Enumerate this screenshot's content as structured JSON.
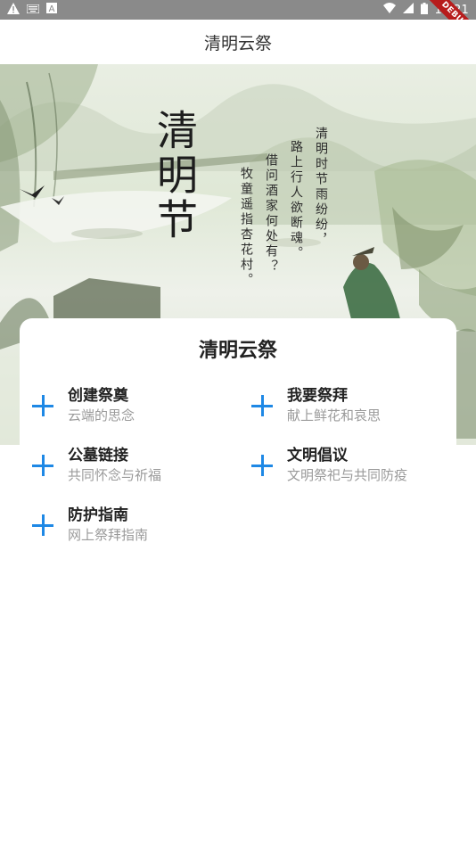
{
  "status_bar": {
    "time": "17:21",
    "debug_label": "DEBUG",
    "left_icons": [
      "warning-icon",
      "keyboard-icon",
      "a-box-icon"
    ],
    "right_icons": [
      "wifi-icon",
      "signal-icon",
      "battery-icon"
    ]
  },
  "appbar": {
    "title": "清明云祭"
  },
  "banner": {
    "calligraphy": "清明节",
    "poem": [
      "清明时节雨纷纷，",
      "路上行人欲断魂。",
      "借问酒家何处有？",
      "牧童遥指杏花村。"
    ]
  },
  "card": {
    "title": "清明云祭",
    "items": [
      {
        "title": "创建祭奠",
        "subtitle": "云端的思念",
        "icon": "plus-icon"
      },
      {
        "title": "我要祭拜",
        "subtitle": "献上鲜花和哀思",
        "icon": "plus-icon"
      },
      {
        "title": "公墓链接",
        "subtitle": "共同怀念与祈福",
        "icon": "plus-icon"
      },
      {
        "title": "文明倡议",
        "subtitle": "文明祭祀与共同防疫",
        "icon": "plus-icon"
      },
      {
        "title": "防护指南",
        "subtitle": "网上祭拜指南",
        "icon": "plus-icon"
      }
    ]
  },
  "colors": {
    "accent": "#1e88e5",
    "status_bar": "#8a8a8a",
    "debug_ribbon": "#b71c1c"
  }
}
